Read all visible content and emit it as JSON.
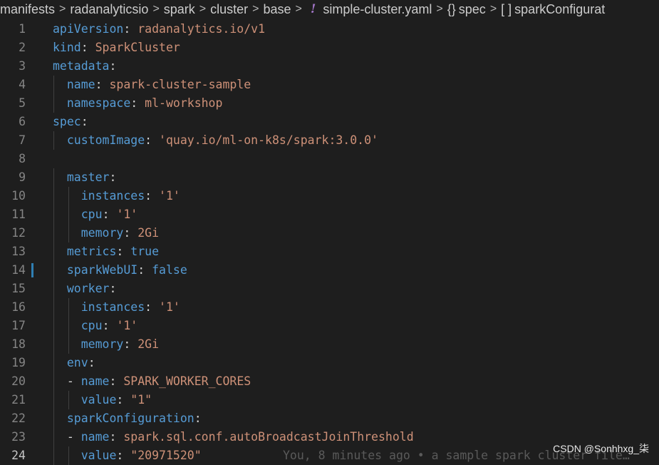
{
  "breadcrumb": {
    "items": [
      "manifests",
      "radanalyticsio",
      "spark",
      "cluster",
      "base"
    ],
    "yaml_icon": "!",
    "file": "simple-cluster.yaml",
    "spec_icon": "{}",
    "spec": "spec",
    "array_icon": "[ ]",
    "last": "sparkConfigurat"
  },
  "editor": {
    "active_line": 24,
    "lines": [
      {
        "n": "1",
        "t": [
          [
            "k",
            "apiVersion"
          ],
          [
            "p",
            ": "
          ],
          [
            "v",
            "radanalytics.io/v1"
          ]
        ]
      },
      {
        "n": "2",
        "t": [
          [
            "k",
            "kind"
          ],
          [
            "p",
            ": "
          ],
          [
            "v",
            "SparkCluster"
          ]
        ]
      },
      {
        "n": "3",
        "t": [
          [
            "k",
            "metadata"
          ],
          [
            "p",
            ":"
          ]
        ]
      },
      {
        "n": "4",
        "t": [
          [
            "p",
            "  "
          ],
          [
            "k",
            "name"
          ],
          [
            "p",
            ": "
          ],
          [
            "v",
            "spark-cluster-sample"
          ]
        ]
      },
      {
        "n": "5",
        "t": [
          [
            "p",
            "  "
          ],
          [
            "k",
            "namespace"
          ],
          [
            "p",
            ": "
          ],
          [
            "v",
            "ml-workshop"
          ]
        ]
      },
      {
        "n": "6",
        "t": [
          [
            "k",
            "spec"
          ],
          [
            "p",
            ":"
          ]
        ]
      },
      {
        "n": "7",
        "t": [
          [
            "p",
            "  "
          ],
          [
            "k",
            "customImage"
          ],
          [
            "p",
            ": "
          ],
          [
            "v",
            "'quay.io/ml-on-k8s/spark:3.0.0'"
          ]
        ]
      },
      {
        "n": "8",
        "t": []
      },
      {
        "n": "9",
        "t": [
          [
            "p",
            "  "
          ],
          [
            "k",
            "master"
          ],
          [
            "p",
            ":"
          ]
        ]
      },
      {
        "n": "10",
        "t": [
          [
            "p",
            "    "
          ],
          [
            "k",
            "instances"
          ],
          [
            "p",
            ": "
          ],
          [
            "v",
            "'1'"
          ]
        ]
      },
      {
        "n": "11",
        "t": [
          [
            "p",
            "    "
          ],
          [
            "k",
            "cpu"
          ],
          [
            "p",
            ": "
          ],
          [
            "v",
            "'1'"
          ]
        ]
      },
      {
        "n": "12",
        "t": [
          [
            "p",
            "    "
          ],
          [
            "k",
            "memory"
          ],
          [
            "p",
            ": "
          ],
          [
            "v",
            "2Gi"
          ]
        ]
      },
      {
        "n": "13",
        "t": [
          [
            "p",
            "  "
          ],
          [
            "k",
            "metrics"
          ],
          [
            "p",
            ": "
          ],
          [
            "b",
            "true"
          ]
        ]
      },
      {
        "n": "14",
        "t": [
          [
            "p",
            "  "
          ],
          [
            "k",
            "sparkWebUI"
          ],
          [
            "p",
            ": "
          ],
          [
            "b",
            "false"
          ]
        ]
      },
      {
        "n": "15",
        "t": [
          [
            "p",
            "  "
          ],
          [
            "k",
            "worker"
          ],
          [
            "p",
            ":"
          ]
        ]
      },
      {
        "n": "16",
        "t": [
          [
            "p",
            "    "
          ],
          [
            "k",
            "instances"
          ],
          [
            "p",
            ": "
          ],
          [
            "v",
            "'1'"
          ]
        ]
      },
      {
        "n": "17",
        "t": [
          [
            "p",
            "    "
          ],
          [
            "k",
            "cpu"
          ],
          [
            "p",
            ": "
          ],
          [
            "v",
            "'1'"
          ]
        ]
      },
      {
        "n": "18",
        "t": [
          [
            "p",
            "    "
          ],
          [
            "k",
            "memory"
          ],
          [
            "p",
            ": "
          ],
          [
            "v",
            "2Gi"
          ]
        ]
      },
      {
        "n": "19",
        "t": [
          [
            "p",
            "  "
          ],
          [
            "k",
            "env"
          ],
          [
            "p",
            ":"
          ]
        ]
      },
      {
        "n": "20",
        "t": [
          [
            "p",
            "  - "
          ],
          [
            "k",
            "name"
          ],
          [
            "p",
            ": "
          ],
          [
            "v",
            "SPARK_WORKER_CORES"
          ]
        ]
      },
      {
        "n": "21",
        "t": [
          [
            "p",
            "    "
          ],
          [
            "k",
            "value"
          ],
          [
            "p",
            ": "
          ],
          [
            "v",
            "\"1\""
          ]
        ]
      },
      {
        "n": "22",
        "t": [
          [
            "p",
            "  "
          ],
          [
            "k",
            "sparkConfiguration"
          ],
          [
            "p",
            ":"
          ]
        ]
      },
      {
        "n": "23",
        "t": [
          [
            "p",
            "  - "
          ],
          [
            "k",
            "name"
          ],
          [
            "p",
            ": "
          ],
          [
            "v",
            "spark.sql.conf.autoBroadcastJoinThreshold"
          ]
        ]
      },
      {
        "n": "24",
        "t": [
          [
            "p",
            "    "
          ],
          [
            "k",
            "value"
          ],
          [
            "p",
            ": "
          ],
          [
            "v",
            "\"20971520\""
          ]
        ]
      }
    ],
    "blame": "You, 8 minutes ago • a sample spark cluster file…"
  },
  "watermark": "CSDN @Sonhhxg_柒",
  "colors": {
    "background": "#1e1e1e",
    "key": "#569cd6",
    "string": "#ce9178",
    "line_number": "#858585",
    "modified_gutter": "#2f7fb3"
  }
}
